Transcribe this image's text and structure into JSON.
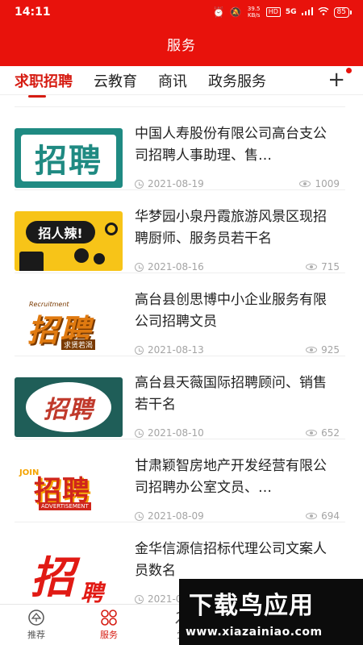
{
  "status_bar": {
    "time": "14:11",
    "net_speed": "39.5 KB/s",
    "hd_badge": "HD",
    "signal": "5G",
    "battery": "85"
  },
  "header": {
    "title": "服务"
  },
  "tabs": [
    {
      "label": "求职招聘",
      "active": true
    },
    {
      "label": "云教育",
      "active": false
    },
    {
      "label": "商讯",
      "active": false
    },
    {
      "label": "政务服务",
      "active": false
    }
  ],
  "tabs_add": "+",
  "items": [
    {
      "title": "中国人寿股份有限公司高台支公司招聘人事助理、售…",
      "date": "2021-08-19",
      "views": "1009",
      "thumb_text": "招聘"
    },
    {
      "title": "华梦园小泉丹霞旅游风景区现招聘厨师、服务员若干名",
      "date": "2021-08-16",
      "views": "715",
      "thumb_text": "招人辣!"
    },
    {
      "title": "高台县创思博中小企业服务有限公司招聘文员",
      "date": "2021-08-13",
      "views": "925",
      "thumb_text": "招聘",
      "thumb_sub": "求贤若渴",
      "thumb_top": "Recruitment"
    },
    {
      "title": "高台县天薇国际招聘顾问、销售若干名",
      "date": "2021-08-10",
      "views": "652",
      "thumb_text": "招聘"
    },
    {
      "title": "甘肃颖智房地产开发经营有限公司招聘办公室文员、…",
      "date": "2021-08-09",
      "views": "694",
      "thumb_text": "招聘",
      "thumb_sub": "ADVERTISEMENT",
      "thumb_top": "JOIN"
    },
    {
      "title": "金华信源信招标代理公司文案人员数名",
      "date": "2021-0",
      "views": "",
      "thumb_text": "招",
      "thumb_sub": "聘"
    }
  ],
  "bottom_nav": [
    {
      "label": "推荐",
      "active": false
    },
    {
      "label": "服务",
      "active": true
    },
    {
      "label": "党",
      "active": false
    }
  ],
  "watermark": {
    "main": "下载鸟应用",
    "url": "www.xiazainiao.com"
  },
  "colors": {
    "brand_red": "#e8120c",
    "active_tab": "#d61c12",
    "teal": "#1f8a82",
    "yellow": "#f7c418"
  }
}
